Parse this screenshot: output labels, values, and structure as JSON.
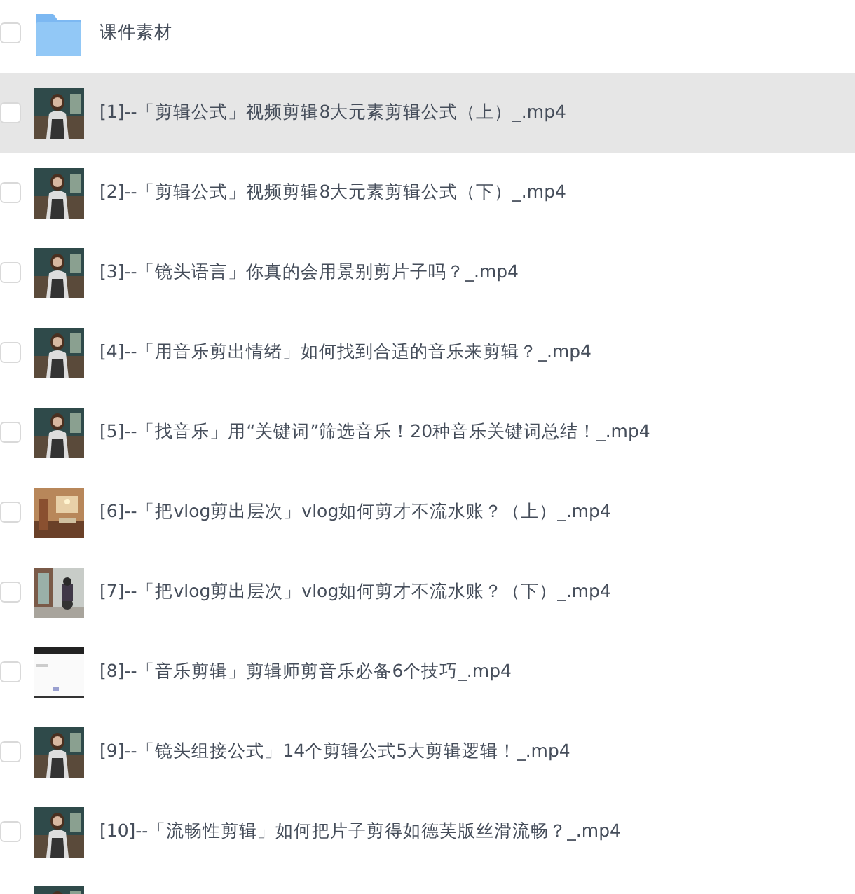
{
  "folder": {
    "name": "课件素材",
    "checked": false
  },
  "files": [
    {
      "name": "[1]--「剪辑公式」视频剪辑8大元素剪辑公式（上）_.mp4",
      "checked": false,
      "highlighted": true
    },
    {
      "name": "[2]--「剪辑公式」视频剪辑8大元素剪辑公式（下）_.mp4",
      "checked": false,
      "highlighted": false
    },
    {
      "name": "[3]--「镜头语言」你真的会用景别剪片子吗？_.mp4",
      "checked": false,
      "highlighted": false
    },
    {
      "name": "[4]--「用音乐剪出情绪」如何找到合适的音乐来剪辑？_.mp4",
      "checked": false,
      "highlighted": false
    },
    {
      "name": "[5]--「找音乐」用“关键词”筛选音乐！20种音乐关键词总结！_.mp4",
      "checked": false,
      "highlighted": false
    },
    {
      "name": "[6]--「把vlog剪出层次」vlog如何剪才不流水账？（上）_.mp4",
      "checked": false,
      "highlighted": false
    },
    {
      "name": "[7]--「把vlog剪出层次」vlog如何剪才不流水账？（下）_.mp4",
      "checked": false,
      "highlighted": false
    },
    {
      "name": "[8]--「音乐剪辑」剪辑师剪音乐必备6个技巧_.mp4",
      "checked": false,
      "highlighted": false
    },
    {
      "name": "[9]--「镜头组接公式」14个剪辑公式5大剪辑逻辑！_.mp4",
      "checked": false,
      "highlighted": false
    },
    {
      "name": "[10]--「流畅性剪辑」如何把片子剪得如德芙版丝滑流畅？_.mp4",
      "checked": false,
      "highlighted": false
    }
  ]
}
